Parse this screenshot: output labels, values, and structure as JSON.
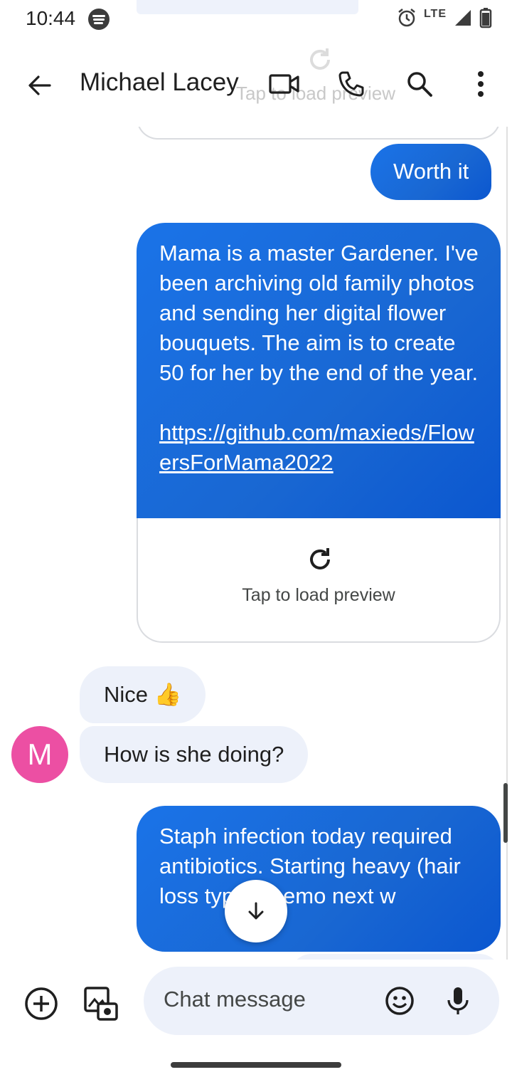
{
  "status_bar": {
    "time": "10:44",
    "network": "LTE",
    "icons": [
      "spotify-icon",
      "alarm-icon",
      "signal-icon",
      "battery-icon"
    ]
  },
  "app_bar": {
    "contact_name": "Michael Lacey",
    "icons": [
      "back-arrow-icon",
      "video-call-icon",
      "phone-call-icon",
      "search-icon",
      "more-options-icon"
    ]
  },
  "messages": {
    "worth_it": "Worth it",
    "long_text": "Mama is a master Gardener. I've been archiving old family photos and sending her digital flower bouquets. The aim is to create 50 for her by the end of the year.",
    "long_link": "https://github.com/maxieds/FlowersForMama2022",
    "preview_text": "Tap to load preview",
    "nice": "Nice 👍",
    "how_is_she": "How is she doing?",
    "avatar_initial": "M",
    "staph": "Staph infection today required antibiotics. Starting heavy (hair loss type) chemo next w"
  },
  "compose": {
    "placeholder": "Chat message",
    "icons": [
      "add-icon",
      "gallery-camera-icon",
      "emoji-icon",
      "microphone-icon"
    ]
  },
  "colors": {
    "outgoing_bubble": "#1a73e8",
    "incoming_bubble": "#edf1fa",
    "avatar": "#ec4fa3"
  }
}
